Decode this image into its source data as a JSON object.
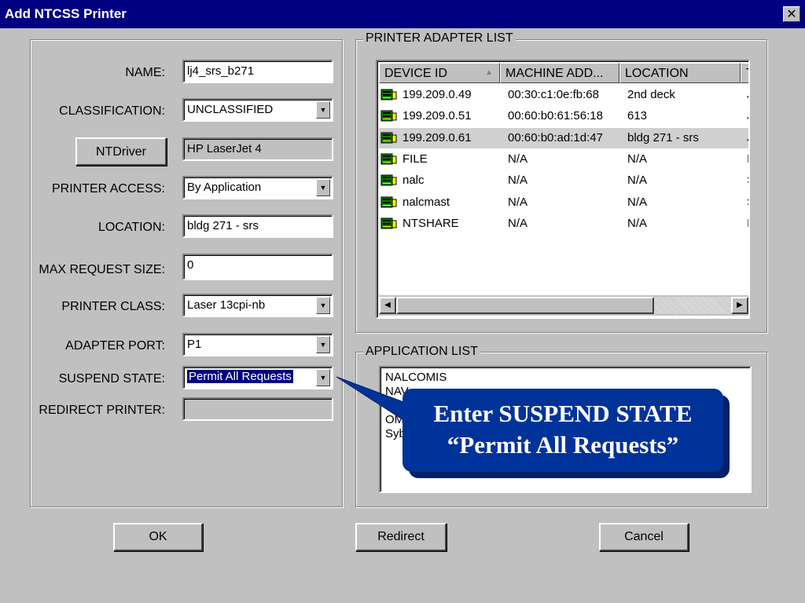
{
  "window": {
    "title": "Add NTCSS Printer",
    "close_glyph": "✕",
    "close_icon": "close-icon"
  },
  "form": {
    "name_label": "NAME:",
    "name_value": "lj4_srs_b271",
    "classification_label": "CLASSIFICATION:",
    "classification_value": "UNCLASSIFIED",
    "ntdriver_button": "NTDriver",
    "ntdriver_value": "HP LaserJet 4",
    "access_label": "PRINTER ACCESS:",
    "access_value": "By Application",
    "location_label": "LOCATION:",
    "location_value": "bldg 271 - srs",
    "max_label": "MAX REQUEST SIZE:",
    "max_value": "0",
    "class_label": "PRINTER CLASS:",
    "class_value": "Laser 13cpi-nb",
    "port_label": "ADAPTER PORT:",
    "port_value": "P1",
    "suspend_label": "SUSPEND STATE:",
    "suspend_value": "Permit All Requests",
    "redirect_label": "REDIRECT PRINTER:",
    "redirect_value": ""
  },
  "adapter_list": {
    "group_label": "PRINTER ADAPTER LIST",
    "columns": [
      "DEVICE ID",
      "MACHINE ADD...",
      "LOCATION",
      "T"
    ],
    "sort_glyph": "▲",
    "rows": [
      {
        "device": "199.209.0.49",
        "machine": "00:30:c1:0e:fb:68",
        "location": "2nd deck",
        "t": "J",
        "icon": "printer-adapter-icon"
      },
      {
        "device": "199.209.0.51",
        "machine": "00:60:b0:61:56:18",
        "location": "613",
        "t": "J",
        "icon": "printer-adapter-icon"
      },
      {
        "device": "199.209.0.61",
        "machine": "00:60:b0:ad:1d:47",
        "location": "bldg 271 - srs",
        "t": "J",
        "icon": "printer-adapter-icon",
        "selected": true
      },
      {
        "device": "FILE",
        "machine": "N/A",
        "location": "N/A",
        "t": "I",
        "icon": "printer-adapter-icon"
      },
      {
        "device": "nalc",
        "machine": "N/A",
        "location": "N/A",
        "t": "S",
        "icon": "printer-adapter-icon"
      },
      {
        "device": "nalcmast",
        "machine": "N/A",
        "location": "N/A",
        "t": "S",
        "icon": "printer-adapter-icon"
      },
      {
        "device": "NTSHARE",
        "machine": "N/A",
        "location": "N/A",
        "t": "I",
        "icon": "printer-adapter-icon"
      }
    ]
  },
  "application_list": {
    "group_label": "APPLICATION LIST",
    "items": [
      "NALCOMIS",
      "NAV",
      "",
      "OM",
      "Syb"
    ]
  },
  "buttons": {
    "ok": "OK",
    "redirect": "Redirect",
    "cancel": "Cancel"
  },
  "callout": {
    "line1": "Enter SUSPEND STATE",
    "line2": "“Permit All Requests”",
    "color": "#003399"
  },
  "colors": {
    "titlebar": "#000080",
    "dialog": "#c0c0c0",
    "selection": "#000080"
  }
}
